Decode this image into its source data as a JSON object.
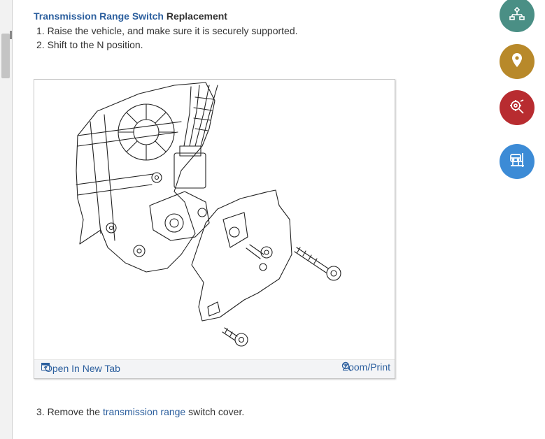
{
  "document": {
    "title_link": "Transmission Range Switch",
    "title_rest": " Replacement",
    "steps": [
      "1. Raise the vehicle, and make sure it is securely supported.",
      "2. Shift to the N position."
    ],
    "step3": {
      "prefix": "3. Remove the ",
      "link": "transmission range",
      "suffix": " switch cover."
    }
  },
  "figure": {
    "open_label": "Open In New Tab",
    "zoom_label": "Zoom/Print"
  },
  "side_buttons": [
    {
      "icon": "component-tree-icon",
      "color": "#4a8f85"
    },
    {
      "icon": "location-pin-icon",
      "color": "#b8892a"
    },
    {
      "icon": "tools-gear-icon",
      "color": "#b82c30"
    },
    {
      "icon": "vehicle-lift-icon",
      "color": "#3c8bd6"
    }
  ]
}
